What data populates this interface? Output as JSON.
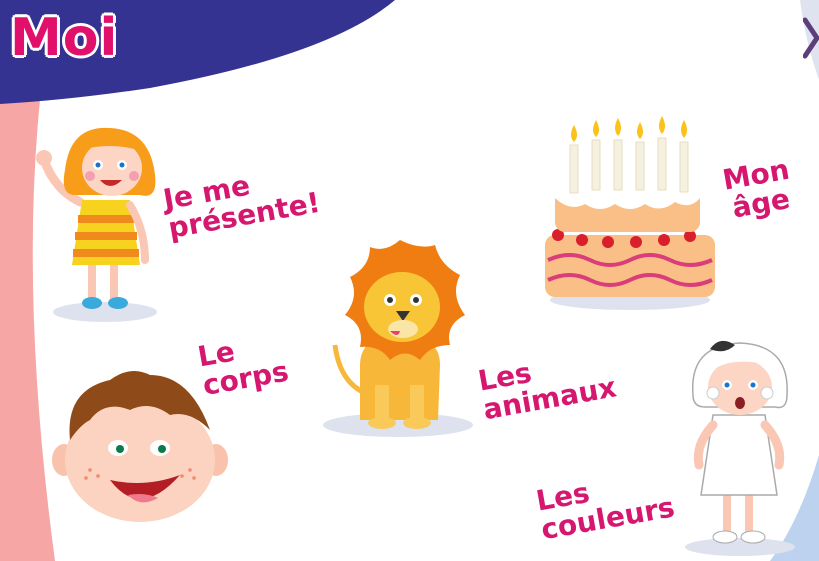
{
  "title": "Moi",
  "menu": [
    {
      "id": "presente",
      "line1": "Je me",
      "line2": "présente!"
    },
    {
      "id": "age",
      "line1": "Mon",
      "line2": "âge"
    },
    {
      "id": "corps",
      "line1": "Le",
      "line2": "corps"
    },
    {
      "id": "animaux",
      "line1": "Les",
      "line2": "animaux"
    },
    {
      "id": "couleurs",
      "line1": "Les",
      "line2": "couleurs"
    }
  ],
  "colors": {
    "title": "#e0106b",
    "label": "#d6176f",
    "header": "#343391",
    "left_band": "#f4a3a3"
  },
  "icons": [
    "girl-waving-icon",
    "birthday-cake-icon",
    "boy-face-icon",
    "lion-icon",
    "girl-white-dress-icon",
    "next-arrow-icon"
  ]
}
